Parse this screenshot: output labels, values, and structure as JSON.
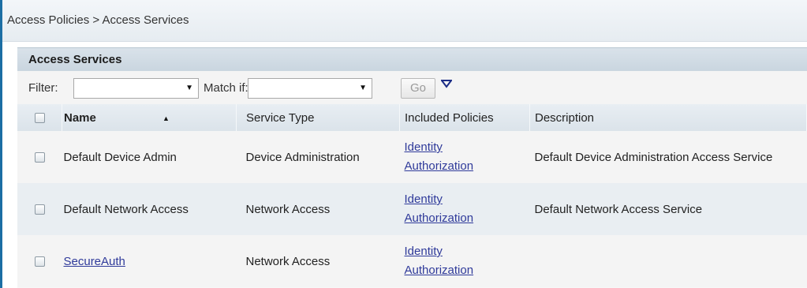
{
  "breadcrumb": "Access Policies > Access Services",
  "panel": {
    "title": "Access Services"
  },
  "filter": {
    "filter_label": "Filter:",
    "match_label": "Match if:",
    "filter_value": "",
    "match_value": "",
    "go_label": "Go",
    "menu_icon": "triangle-down-icon"
  },
  "table": {
    "columns": [
      "",
      "Name",
      "Service Type",
      "Included Policies",
      "Description"
    ],
    "sort": {
      "column": "Name",
      "direction": "ascending",
      "icon": "sort-up-icon"
    },
    "rows": [
      {
        "name": "Default Device Admin",
        "name_is_link": false,
        "service_type": "Device Administration",
        "policies": [
          "Identity",
          "Authorization"
        ],
        "description": "Default Device Administration Access Service"
      },
      {
        "name": "Default Network Access",
        "name_is_link": false,
        "service_type": "Network Access",
        "policies": [
          "Identity",
          "Authorization"
        ],
        "description": "Default Network Access Service"
      },
      {
        "name": "SecureAuth",
        "name_is_link": true,
        "service_type": "Network Access",
        "policies": [
          "Identity",
          "Authorization"
        ],
        "description": ""
      }
    ]
  },
  "colors": {
    "accent": "#1c6ea4",
    "link": "#2f3a9a",
    "header_bg": "#c9d5df",
    "row_alt_bg": "#e9eef2"
  }
}
